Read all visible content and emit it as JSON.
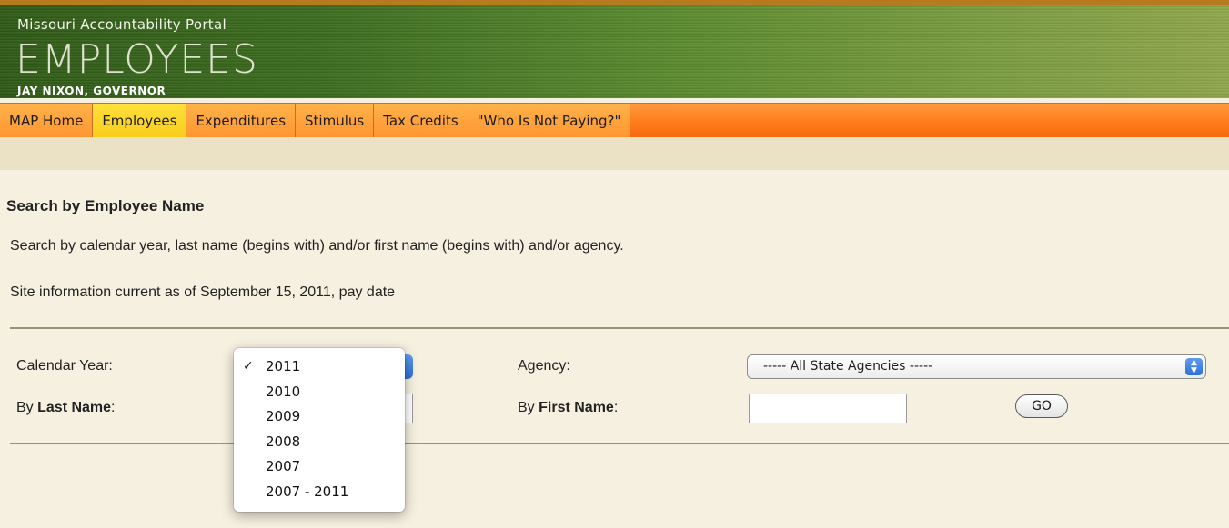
{
  "header": {
    "portal_name": "Missouri Accountability Portal",
    "section_title": "EMPLOYEES",
    "governor": "JAY NIXON, GOVERNOR"
  },
  "nav": {
    "items": [
      {
        "label": "MAP Home",
        "active": false
      },
      {
        "label": "Employees",
        "active": true
      },
      {
        "label": "Expenditures",
        "active": false
      },
      {
        "label": "Stimulus",
        "active": false
      },
      {
        "label": "Tax Credits",
        "active": false
      },
      {
        "label": "\"Who Is Not Paying?\"",
        "active": false
      }
    ]
  },
  "main": {
    "heading": "Search by Employee Name",
    "description": "Search by calendar year, last name (begins with) and/or first name (begins with) and/or agency.",
    "currency_note": "Site information current as of September 15, 2011, pay date"
  },
  "form": {
    "calendar_year_label": "Calendar Year:",
    "last_name_prefix": "By ",
    "last_name_bold": "Last Name",
    "last_name_suffix": ":",
    "agency_label": "Agency:",
    "agency_selected": "----- All State Agencies -----",
    "first_name_prefix": "By ",
    "first_name_bold": "First Name",
    "first_name_suffix": ":",
    "last_name_value": "",
    "first_name_value": "",
    "go_label": "GO"
  },
  "year_dropdown": {
    "check_glyph": "✓",
    "selected": "2011",
    "options": [
      "2011",
      "2010",
      "2009",
      "2008",
      "2007",
      "2007 - 2011"
    ]
  },
  "colors": {
    "nav_orange": "#ff7a1a",
    "nav_active": "#f9cc1c",
    "header_green": "#3b6b1f",
    "page_bg": "#f6f0e0"
  }
}
